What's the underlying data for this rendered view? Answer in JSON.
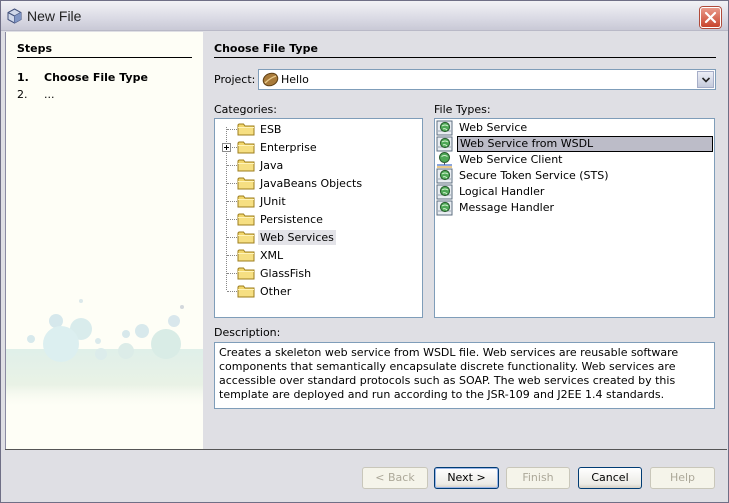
{
  "window": {
    "title": "New File",
    "close_icon": "close-icon"
  },
  "steps": {
    "title": "Steps",
    "items": [
      {
        "num": "1.",
        "label": "Choose File Type",
        "current": true
      },
      {
        "num": "2.",
        "label": "...",
        "current": false
      }
    ]
  },
  "main": {
    "title": "Choose File Type",
    "project": {
      "label": "Project:",
      "value": "Hello",
      "icon": "java-bean-icon"
    },
    "categories": {
      "label": "Categories:",
      "selected": "Web Services",
      "items": [
        {
          "label": "ESB",
          "expandable": false
        },
        {
          "label": "Enterprise",
          "expandable": true
        },
        {
          "label": "Java",
          "expandable": false
        },
        {
          "label": "JavaBeans Objects",
          "expandable": false
        },
        {
          "label": "JUnit",
          "expandable": false
        },
        {
          "label": "Persistence",
          "expandable": false
        },
        {
          "label": "Web Services",
          "expandable": false
        },
        {
          "label": "XML",
          "expandable": false
        },
        {
          "label": "GlassFish",
          "expandable": false
        },
        {
          "label": "Other",
          "expandable": false
        }
      ]
    },
    "file_types": {
      "label": "File Types:",
      "selected": "Web Service from WSDL",
      "items": [
        {
          "label": "Web Service",
          "icon": "web-service-icon"
        },
        {
          "label": "Web Service from WSDL",
          "icon": "web-service-icon"
        },
        {
          "label": "Web Service Client",
          "icon": "web-service-client-icon"
        },
        {
          "label": "Secure Token Service (STS)",
          "icon": "web-service-icon"
        },
        {
          "label": "Logical Handler",
          "icon": "web-service-icon"
        },
        {
          "label": "Message Handler",
          "icon": "web-service-icon"
        }
      ]
    },
    "description": {
      "label": "Description:",
      "text": "Creates a skeleton web service from WSDL file. Web services are reusable software components that semantically encapsulate discrete functionality. Web services are accessible over standard protocols such as SOAP. The web services created by this template are deployed and run according to the JSR-109 and J2EE 1.4 standards."
    }
  },
  "buttons": {
    "back": "< Back",
    "next": "Next >",
    "finish": "Finish",
    "cancel": "Cancel",
    "help": "Help"
  }
}
